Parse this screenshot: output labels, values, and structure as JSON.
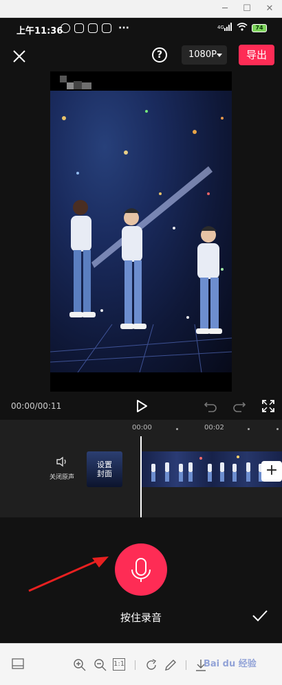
{
  "status": {
    "time": "上午11:36",
    "signal": "4G",
    "battery": "74"
  },
  "topbar": {
    "resolution": "1080P",
    "export_label": "导出",
    "help_label": "?"
  },
  "player": {
    "time_display": "00:00/00:11"
  },
  "timeline": {
    "ruler": [
      "00:00",
      "00:02"
    ],
    "mute_label": "关闭原声",
    "cover_label": "设置\n封面",
    "add_label": "+"
  },
  "record": {
    "hint": "按住录音"
  },
  "bottom": {
    "ratio_label": "1:1",
    "watermark": "Bai du 经验"
  },
  "colors": {
    "accent": "#fe2c55",
    "background": "#121212"
  }
}
